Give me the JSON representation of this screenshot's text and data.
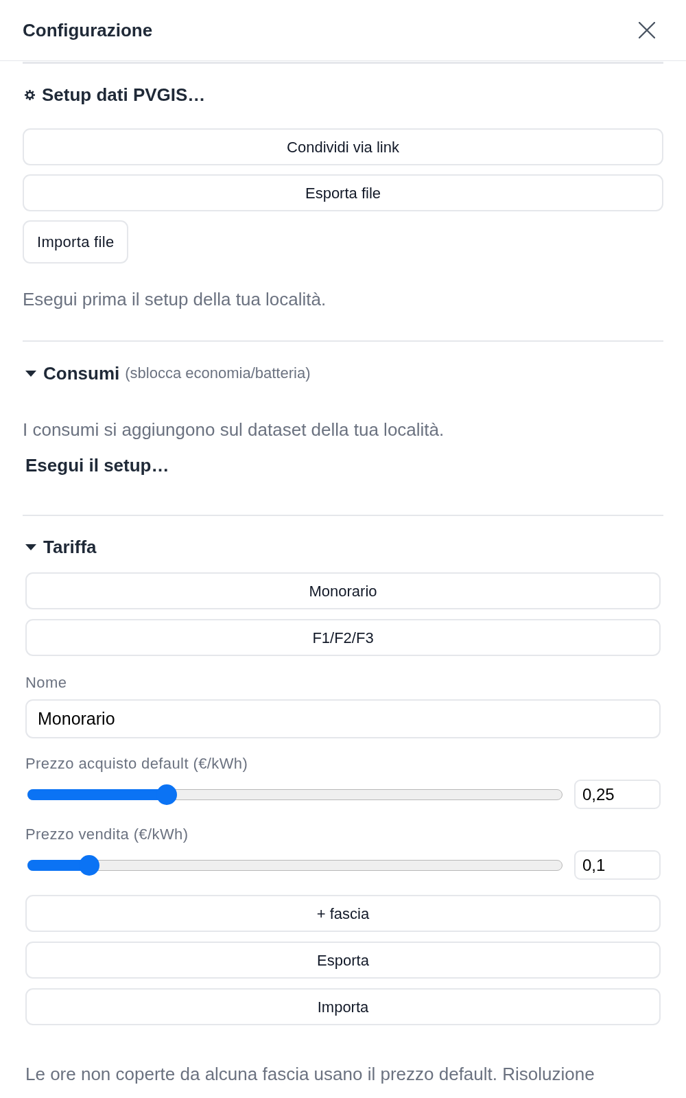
{
  "dialog": {
    "title": "Configurazione"
  },
  "pvgis_section": {
    "heading": "Setup dati PVGIS…",
    "buttons": [
      {
        "label": "Condividi via link",
        "kind": "full"
      },
      {
        "label": "Esporta file",
        "kind": "full"
      },
      {
        "label": "Importa file",
        "kind": "compact"
      }
    ],
    "note": "Esegui prima il setup della tua località."
  },
  "consumi_section": {
    "heading": "Consumi",
    "subheading": "(sblocca economia/batteria)",
    "expanded": true,
    "note": "I consumi si aggiungono sul dataset della tua località.",
    "action": "Esegui il setup…"
  },
  "tariffa_section": {
    "heading": "Tariffa",
    "expanded": true,
    "plan_buttons": [
      "Monorario",
      "F1/F2/F3"
    ],
    "name_field": {
      "label": "Nome",
      "value": "Monorario"
    },
    "sliders": [
      {
        "label": "Prezzo acquisto default (€/kWh)",
        "level": 0.25,
        "value": "0,25"
      },
      {
        "label": "Prezzo vendita (€/kWh)",
        "level": 0.1,
        "value": "0,1"
      }
    ],
    "buttons": [
      "+ fascia",
      "Esporta",
      "Importa"
    ],
    "note": "Le ore non coperte da alcuna fascia usano il prezzo default. Risoluzione"
  }
}
